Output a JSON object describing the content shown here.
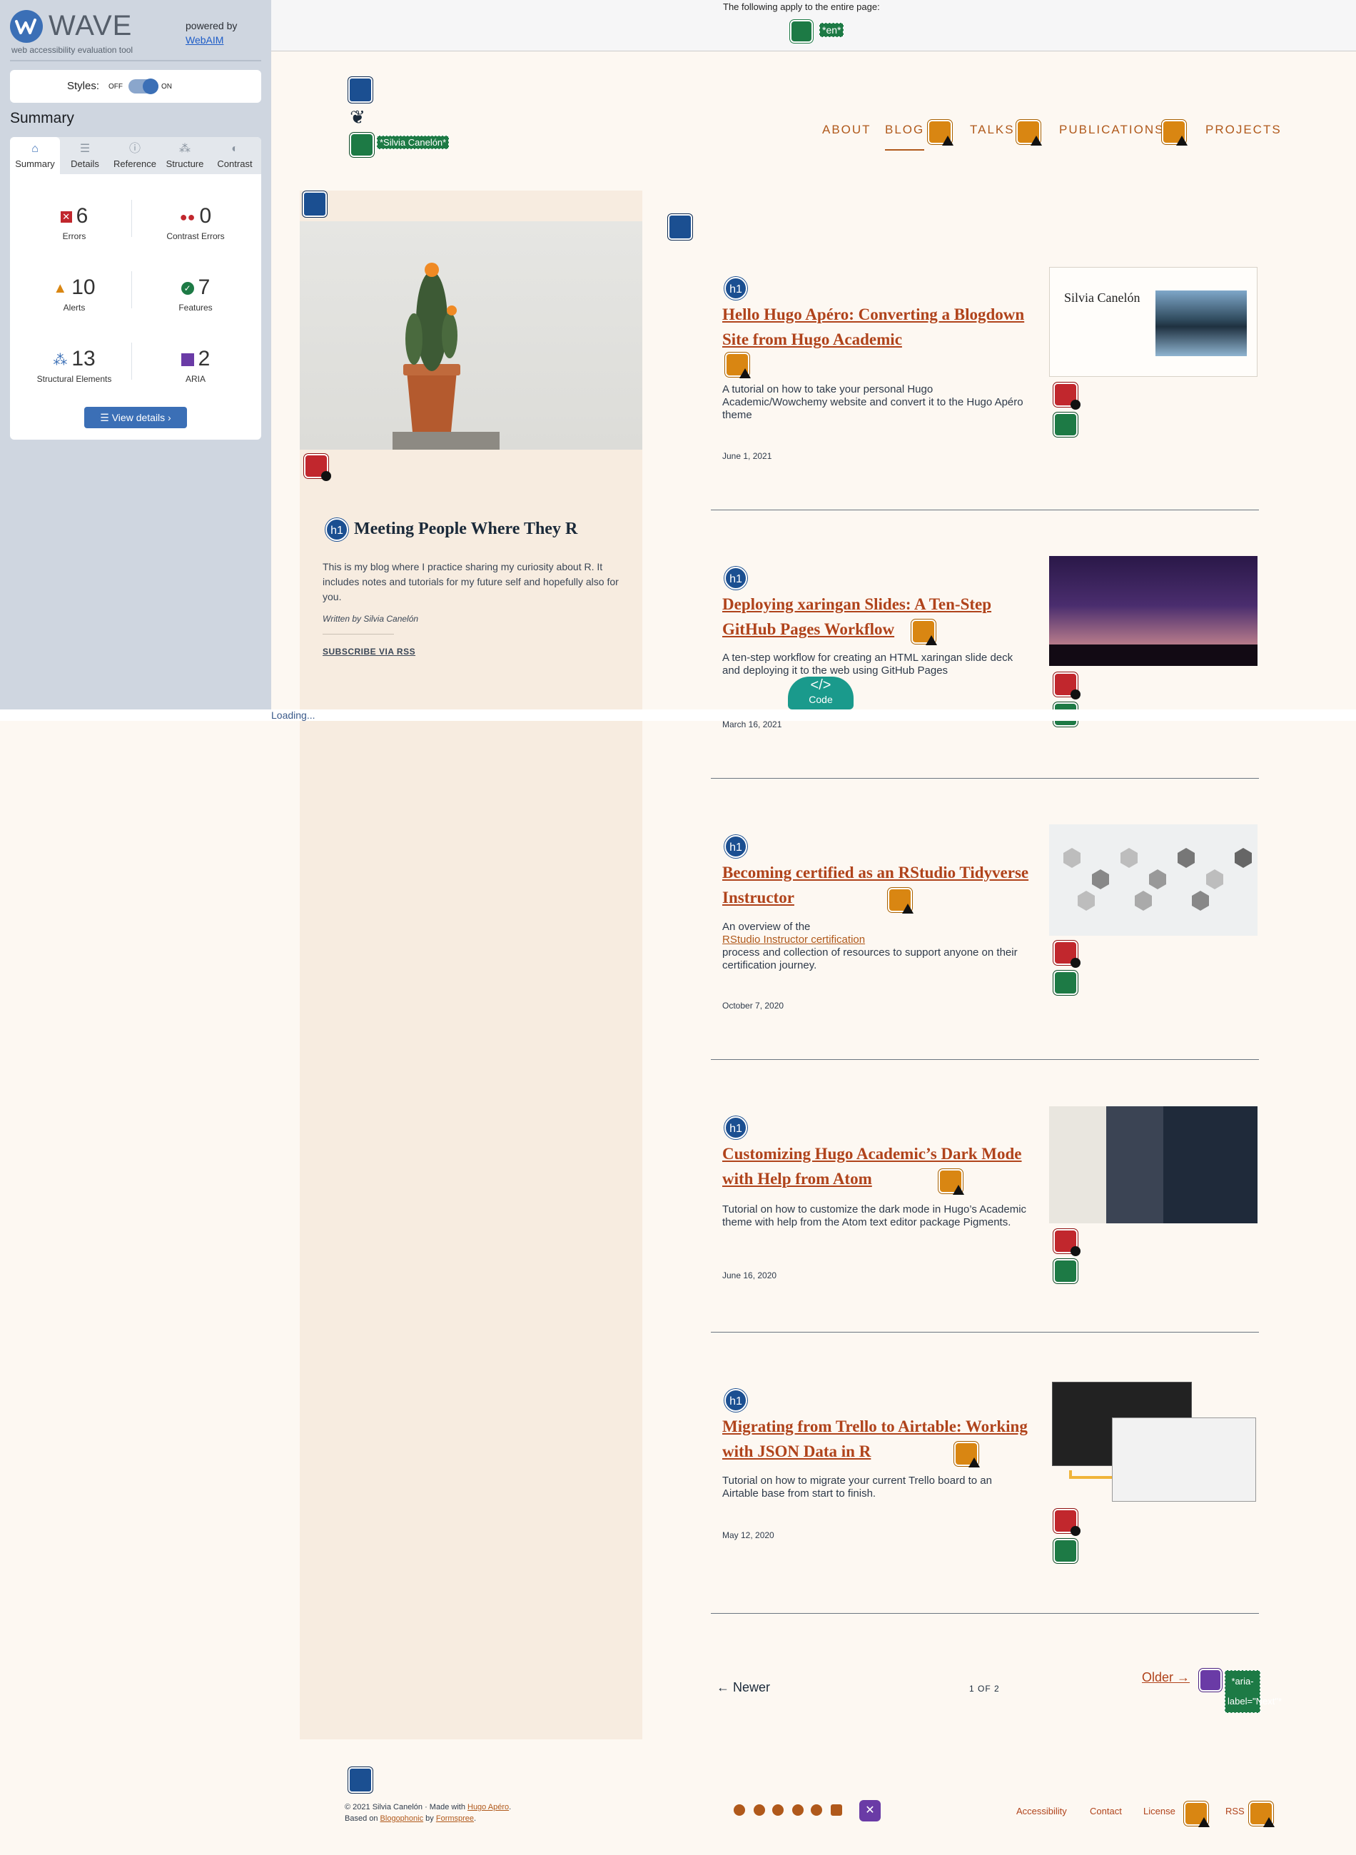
{
  "wave": {
    "brand": "WAVE",
    "tagline": "web accessibility evaluation tool",
    "powered_by": "powered by",
    "webaim": "WebAIM",
    "styles_label": "Styles:",
    "styles_off": "OFF",
    "styles_on": "ON",
    "summary_title": "Summary",
    "tabs": [
      "Summary",
      "Details",
      "Reference",
      "Structure",
      "Contrast"
    ],
    "stats": {
      "errors": {
        "count": "6",
        "label": "Errors"
      },
      "contrast": {
        "count": "0",
        "label": "Contrast Errors"
      },
      "alerts": {
        "count": "10",
        "label": "Alerts"
      },
      "features": {
        "count": "7",
        "label": "Features"
      },
      "structural": {
        "count": "13",
        "label": "Structural Elements"
      },
      "aria": {
        "count": "2",
        "label": "ARIA"
      }
    },
    "view_details": "View details ›",
    "loading": "Loading..."
  },
  "banner": {
    "text": "The following apply to the entire page:",
    "lang": "*en*"
  },
  "site": {
    "alt_label": "*Silvia Canelón*",
    "nav": [
      "ABOUT",
      "BLOG",
      "TALKS",
      "PUBLICATIONS",
      "PROJECTS"
    ],
    "blog_title": "Meeting People Where They R",
    "blog_desc": "This is my blog where I practice sharing my curiosity about R. It includes notes and tutorials for my future self and hopefully also for you.",
    "written_by": "Written by Silvia Canelón",
    "subscribe": "SUBSCRIBE VIA RSS",
    "code_button": "Code"
  },
  "posts": [
    {
      "title": "Hello Hugo Apéro: Converting a Blogdown Site from Hugo Academic",
      "desc": "A tutorial on how to take your personal Hugo Academic/Wowchemy website and convert it to the Hugo Apéro theme",
      "date": "June 1, 2021",
      "thumb_text": "Silvia Canelón"
    },
    {
      "title": "Deploying xaringan Slides: A Ten-Step GitHub Pages Workflow",
      "desc": "A ten-step workflow for creating an HTML xaringan slide deck and deploying it to the web using GitHub Pages",
      "date": "March 16, 2021"
    },
    {
      "title": "Becoming certified as an RStudio Tidyverse Instructor",
      "desc_before": "An overview of the",
      "desc_link": "RStudio Instructor certification",
      "desc_after": "process and collection of resources to support anyone on their certification journey.",
      "date": "October 7, 2020"
    },
    {
      "title": "Customizing Hugo Academic’s Dark Mode with Help from Atom",
      "desc": "Tutorial on how to customize the dark mode in Hugo’s Academic theme with help from the Atom text editor package Pigments.",
      "date": "June 16, 2020"
    },
    {
      "title": "Migrating from Trello to Airtable: Working with JSON Data in R",
      "desc": "Tutorial on how to migrate your current Trello board to an Airtable base from start to finish.",
      "date": "May 12, 2020"
    }
  ],
  "pager": {
    "newer": "← Newer",
    "page": "1 OF 2",
    "older": "Older →",
    "aria_label": "*aria-label=\"Next\"*"
  },
  "footer": {
    "copyright": "© 2021 Silvia Canelón",
    "made_with": "Made with",
    "hugo_apero": "Hugo Apéro",
    "based_on": "Based on",
    "blogophonic": "Blogophonic",
    "by": "by",
    "formspree": "Formspree",
    "links": [
      "Accessibility",
      "Contact",
      "License",
      "RSS"
    ]
  },
  "colors": {
    "accent": "#b0431b",
    "wave_blue": "#3b6fb6",
    "feature_green": "#1d7a45",
    "error_red": "#c1272d",
    "alert_orange": "#d98612"
  }
}
